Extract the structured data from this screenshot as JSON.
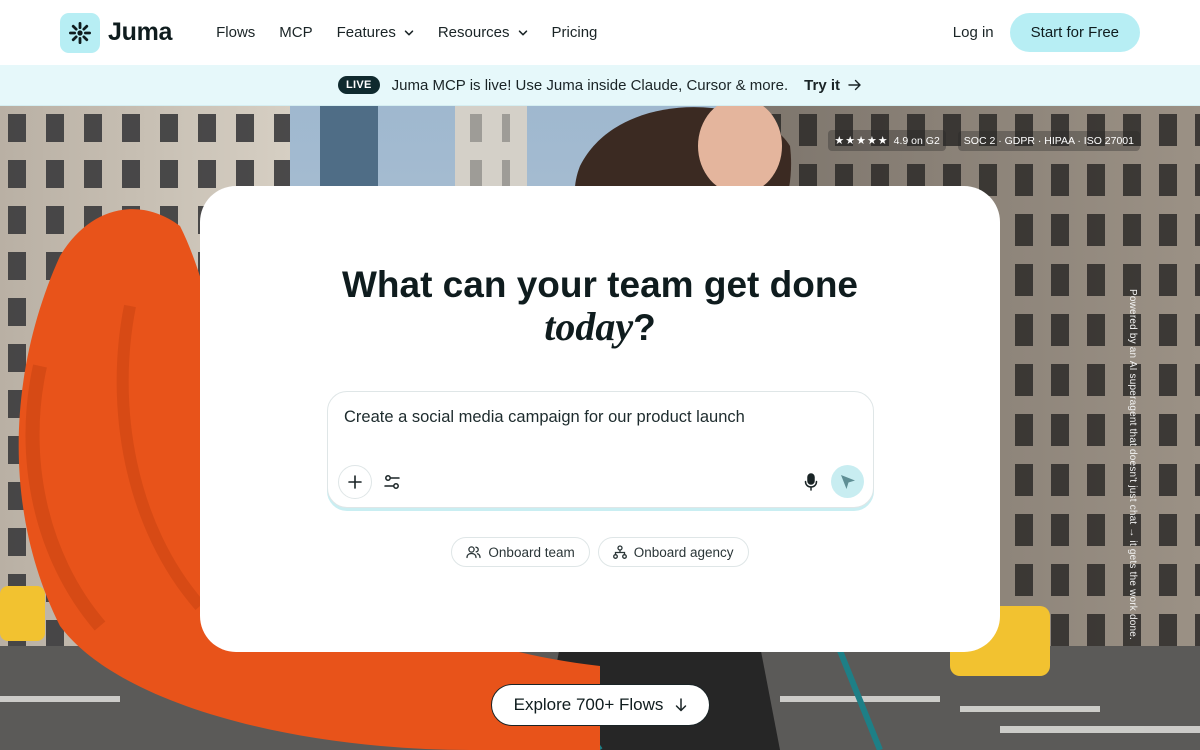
{
  "nav": {
    "logo_text": "Juma",
    "links": [
      {
        "label": "Flows",
        "has_dropdown": false
      },
      {
        "label": "MCP",
        "has_dropdown": false
      },
      {
        "label": "Features",
        "has_dropdown": true
      },
      {
        "label": "Resources",
        "has_dropdown": true
      },
      {
        "label": "Pricing",
        "has_dropdown": false
      }
    ],
    "login_label": "Log in",
    "cta_label": "Start for Free"
  },
  "banner": {
    "badge": "LIVE",
    "text": "Juma MCP is live! Use Juma inside Claude, Cursor & more.",
    "link_label": "Try it"
  },
  "trust": {
    "stars": "★★★★★",
    "rating": "4.9 on G2",
    "compliance": "SOC 2 · GDPR · HIPAA · ISO 27001"
  },
  "side_caption": "Powered by an AI superagent that doesn't just chat → it gets the work done.",
  "hero": {
    "headline_line1": "What can your team get done",
    "headline_italic": "today",
    "headline_end": "?",
    "prompt_value": "Create a social media campaign for our product launch",
    "chips": [
      {
        "label": "Onboard team",
        "icon": "users-icon"
      },
      {
        "label": "Onboard agency",
        "icon": "org-chart-icon"
      }
    ]
  },
  "explore_label": "Explore 700+ Flows",
  "colors": {
    "accent": "#b7eef4",
    "banner_bg": "#e6f8fa",
    "badge_bg": "#0f2a2e",
    "text": "#0f1c1e",
    "hat_orange": "#e8531a"
  }
}
